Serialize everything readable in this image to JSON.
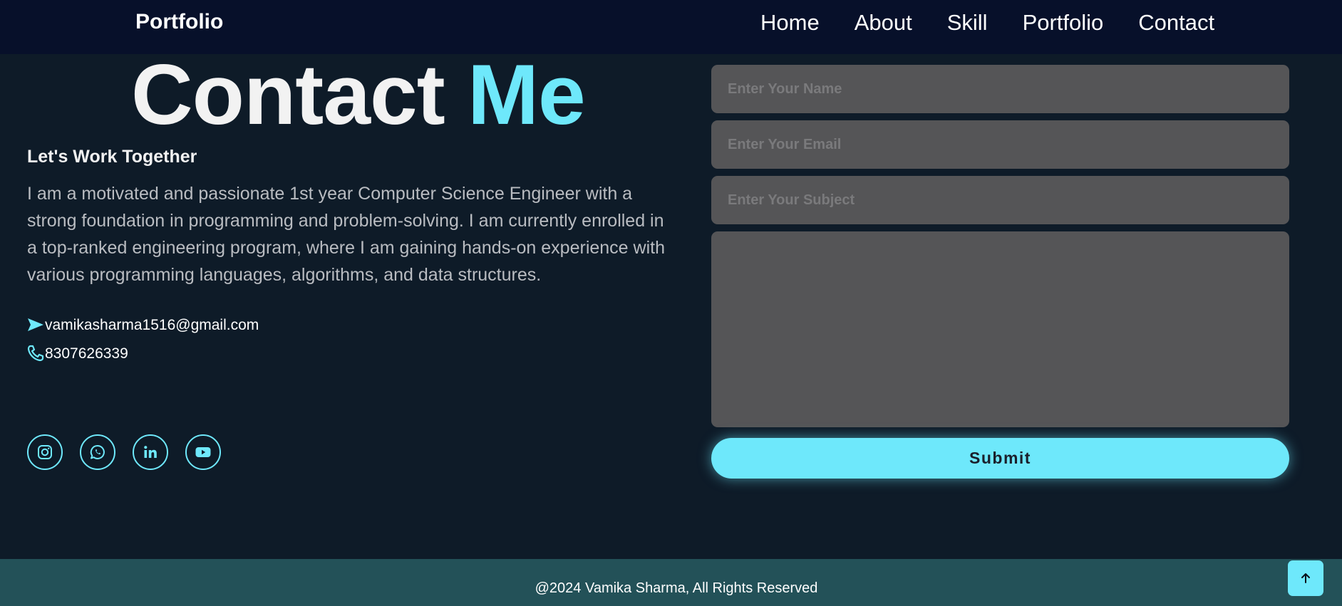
{
  "header": {
    "logo": "Portfolio",
    "nav": [
      "Home",
      "About",
      "Skill",
      "Portfolio",
      "Contact"
    ]
  },
  "contact": {
    "title_part1": "Contact",
    "title_part2": "Me",
    "subheading": "Let's Work Together",
    "about": "I am a motivated and passionate 1st year Computer Science Engineer with a strong foundation in programming and problem-solving. I am currently enrolled in a top-ranked engineering program, where I am gaining hands-on experience with various programming languages, algorithms, and data structures.",
    "email": "vamikasharma1516@gmail.com",
    "phone": "8307626339",
    "email_icon": "send-icon",
    "phone_icon": "phone-icon",
    "socials": [
      "instagram-icon",
      "whatsapp-icon",
      "linkedin-icon",
      "youtube-icon"
    ]
  },
  "form": {
    "name_placeholder": "Enter Your Name",
    "email_placeholder": "Enter Your Email",
    "subject_placeholder": "Enter Your Subject",
    "message_value": "",
    "submit_label": "Submit"
  },
  "footer": {
    "text": "@2024 Vamika Sharma, All Rights Reserved",
    "to_top_icon": "arrow-up-icon"
  },
  "colors": {
    "accent": "#6ee8fb",
    "background": "#0e1b28",
    "header": "#07102a",
    "footer": "#235158",
    "input": "#555557"
  }
}
